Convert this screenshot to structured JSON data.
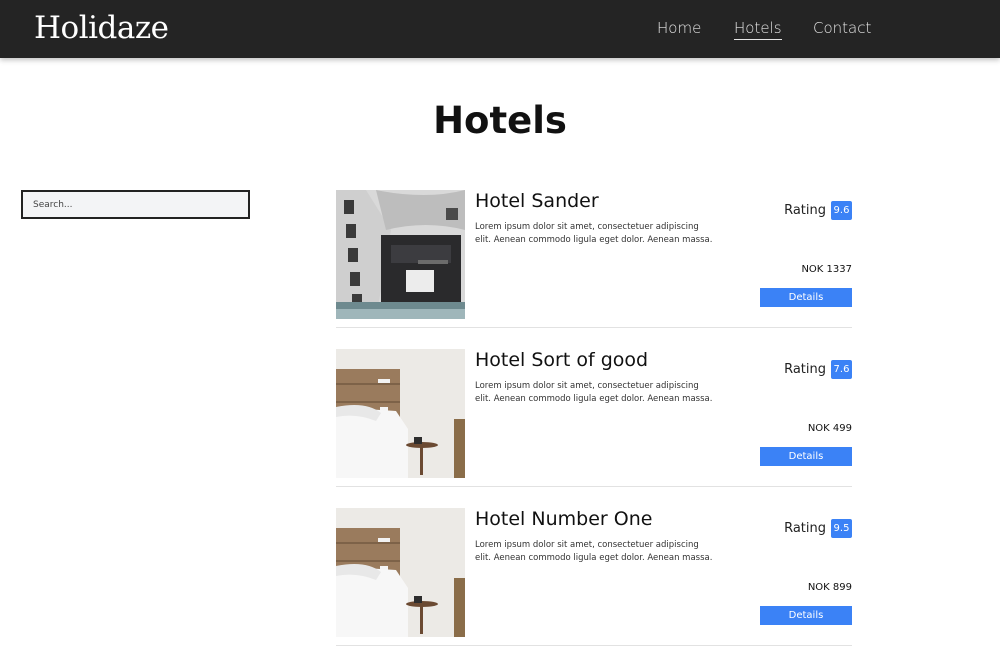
{
  "nav": {
    "logo": "Holidaze",
    "links": [
      {
        "label": "Home",
        "active": false
      },
      {
        "label": "Hotels",
        "active": true
      },
      {
        "label": "Contact",
        "active": false
      }
    ]
  },
  "page": {
    "title": "Hotels"
  },
  "search": {
    "placeholder": "Search...",
    "value": ""
  },
  "hotels": [
    {
      "name": "Hotel Sander",
      "description": "Lorem ipsum dolor sit amet, consectetuer adipiscing elit. Aenean commodo ligula eget dolor. Aenean massa.",
      "rating_label": "Rating",
      "rating": "9.6",
      "price": "NOK 1337",
      "button_label": "Details",
      "image": "hotel-atrium-photo"
    },
    {
      "name": "Hotel Sort of good",
      "description": "Lorem ipsum dolor sit amet, consectetuer adipiscing elit. Aenean commodo ligula eget dolor. Aenean massa.",
      "rating_label": "Rating",
      "rating": "7.6",
      "price": "NOK 499",
      "button_label": "Details",
      "image": "hotel-bedroom-photo"
    },
    {
      "name": "Hotel Number One",
      "description": "Lorem ipsum dolor sit amet, consectetuer adipiscing elit. Aenean commodo ligula eget dolor. Aenean massa.",
      "rating_label": "Rating",
      "rating": "9.5",
      "price": "NOK 899",
      "button_label": "Details",
      "image": "hotel-bedroom-photo"
    }
  ],
  "colors": {
    "nav_bg": "#242424",
    "accent": "#3b82f6"
  }
}
